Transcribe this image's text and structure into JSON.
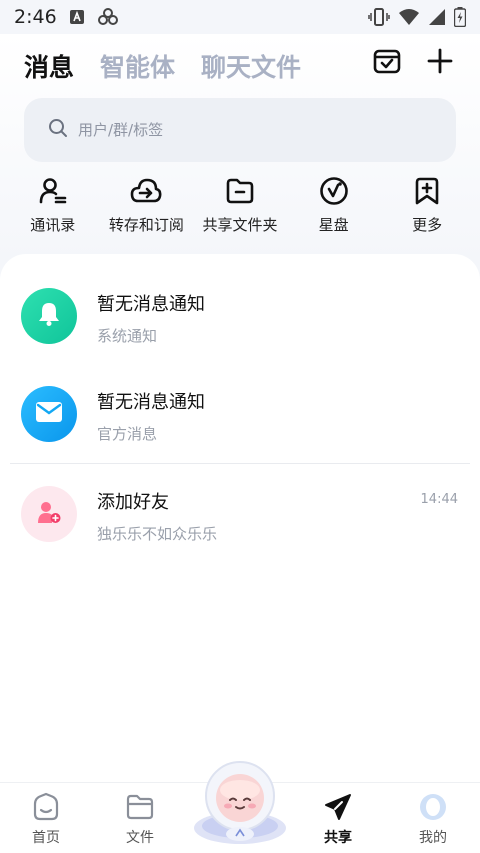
{
  "status_bar": {
    "time": "2:46",
    "icons": [
      "a-letter-icon",
      "cluster-icon",
      "vibrate-icon",
      "wifi-icon",
      "signal-icon",
      "battery-icon"
    ]
  },
  "header": {
    "tabs": [
      {
        "label": "消息",
        "active": true
      },
      {
        "label": "智能体",
        "active": false
      },
      {
        "label": "聊天文件",
        "active": false
      }
    ],
    "actions": [
      "calendar-check-icon",
      "plus-icon"
    ]
  },
  "search": {
    "placeholder": "用户/群/标签",
    "value": ""
  },
  "quick_actions": [
    {
      "label": "通讯录",
      "icon": "contacts-icon"
    },
    {
      "label": "转存和订阅",
      "icon": "cloud-transfer-icon"
    },
    {
      "label": "共享文件夹",
      "icon": "shared-folder-icon"
    },
    {
      "label": "星盘",
      "icon": "star-disk-icon"
    },
    {
      "label": "更多",
      "icon": "more-bookmark-icon"
    }
  ],
  "messages": [
    {
      "title": "暂无消息通知",
      "subtitle": "系统通知",
      "time": "",
      "icon": "bell-icon",
      "color": "#1ed1a2"
    },
    {
      "title": "暂无消息通知",
      "subtitle": "官方消息",
      "time": "",
      "icon": "mail-icon",
      "color": "#13a8f4"
    },
    {
      "title": "添加好友",
      "subtitle": "独乐乐不如众乐乐",
      "time": "14:44",
      "icon": "add-friend-icon",
      "color": "#ff6f8f"
    }
  ],
  "bottom_nav": [
    {
      "label": "首页",
      "icon": "home-face-icon",
      "active": false
    },
    {
      "label": "文件",
      "icon": "folder-icon",
      "active": false
    },
    {
      "label": "共享",
      "icon": "send-icon",
      "active": true
    },
    {
      "label": "我的",
      "icon": "profile-icon",
      "active": false
    }
  ],
  "colors": {
    "accent": "#111111",
    "inactive_tab": "#a9b1c4",
    "search_bg": "#edf0f5",
    "subtitle": "#9aa0ab"
  }
}
